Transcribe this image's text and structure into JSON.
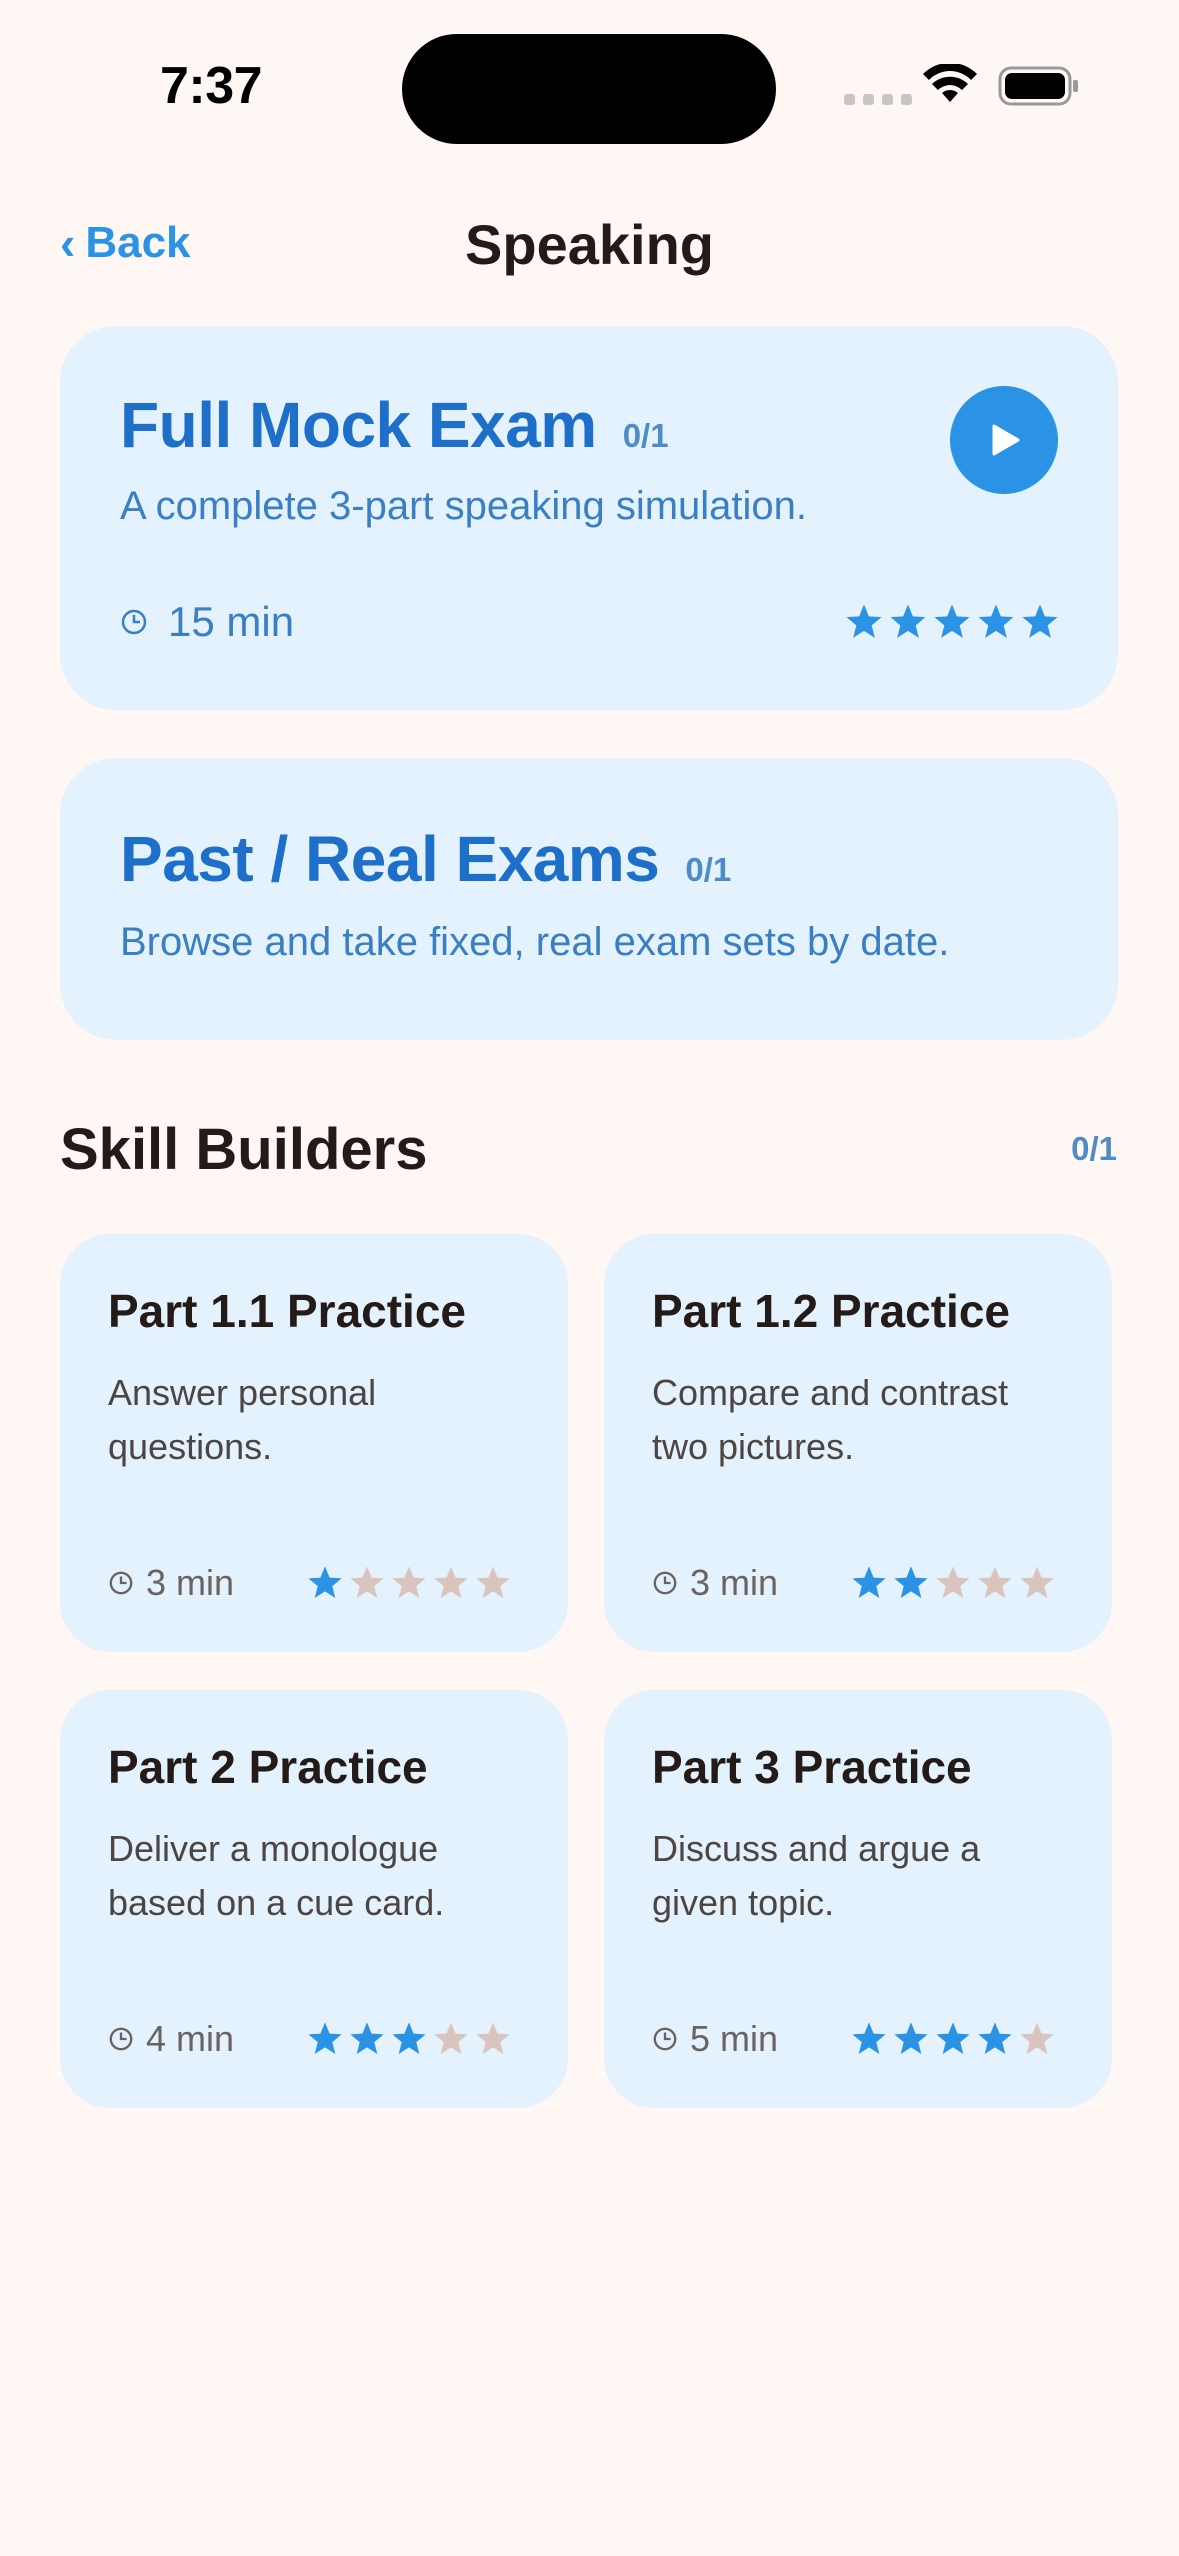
{
  "status_bar": {
    "time": "7:37"
  },
  "nav": {
    "back_label": "Back",
    "back_chevron": "‹",
    "title": "Speaking"
  },
  "mock_exam": {
    "title": "Full Mock Exam",
    "badge": "0/1",
    "description": "A complete 3-part speaking simulation.",
    "duration": "15 min",
    "rating": 5,
    "icon": "play-icon"
  },
  "past_exams": {
    "title": "Past / Real Exams",
    "badge": "0/1",
    "description": "Browse and take fixed, real exam sets by date."
  },
  "skill_builders": {
    "title": "Skill Builders",
    "badge": "0/1",
    "items": [
      {
        "title": "Part 1.1 Practice",
        "description": "Answer personal questions.",
        "duration": "3 min",
        "rating": 1
      },
      {
        "title": "Part 1.2 Practice",
        "description": "Compare and contrast two pictures.",
        "duration": "3 min",
        "rating": 2
      },
      {
        "title": "Part 2 Practice",
        "description": "Deliver a monologue based on a cue card.",
        "duration": "4 min",
        "rating": 3
      },
      {
        "title": "Part 3 Practice",
        "description": "Discuss and argue a given topic.",
        "duration": "5 min",
        "rating": 4
      }
    ]
  },
  "colors": {
    "accent": "#2B93E6",
    "star_filled": "#2B93E6",
    "star_empty": "#D9C5BE",
    "card_bg": "#E3F2FD",
    "page_bg": "#FFF7F4"
  }
}
